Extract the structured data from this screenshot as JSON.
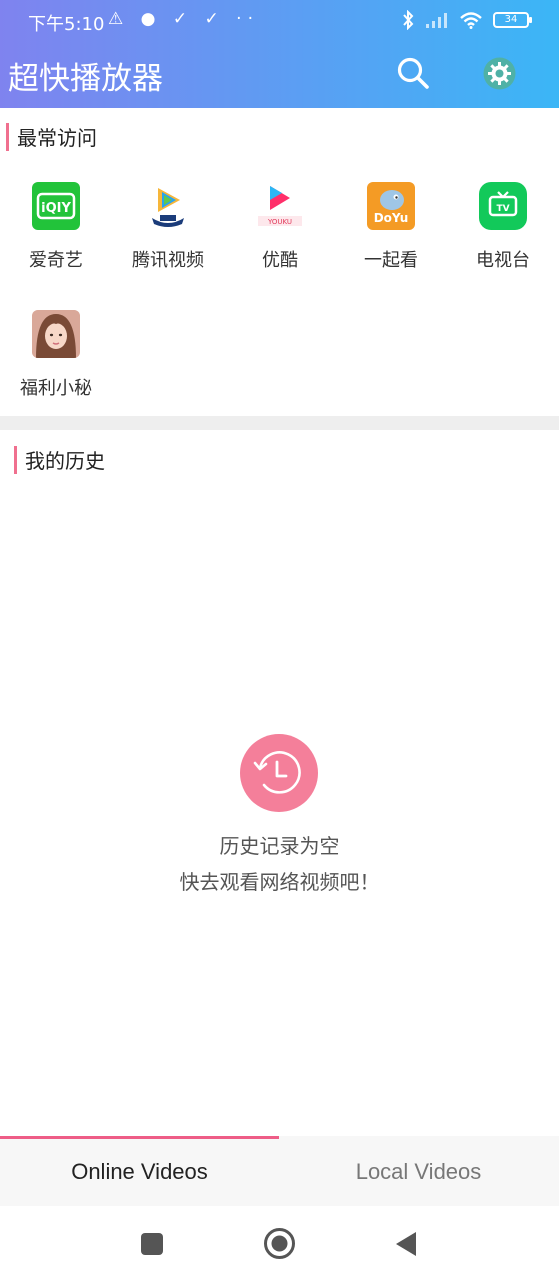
{
  "status_bar": {
    "time": "下午5:10",
    "left_icons": "⚠ ● ✓ ✓ ··",
    "battery": "34"
  },
  "header": {
    "title": "超快播放器",
    "search_icon": "search-icon",
    "settings_icon": "gear-icon"
  },
  "frequent": {
    "title": "最常访问",
    "items": [
      {
        "label": "爱奇艺",
        "icon": "iqiyi-icon",
        "color": "#22c33a"
      },
      {
        "label": "腾讯视频",
        "icon": "tencent-video-icon",
        "color": "#1e88e5"
      },
      {
        "label": "优酷",
        "icon": "youku-icon",
        "color": "#2aa9f5"
      },
      {
        "label": "一起看",
        "icon": "douyu-icon",
        "color": "#f49b25"
      },
      {
        "label": "电视台",
        "icon": "tv-icon",
        "color": "#12c95a"
      },
      {
        "label": "福利小秘",
        "icon": "avatar-icon",
        "color": "#e8b3a0"
      }
    ]
  },
  "history": {
    "title": "我的历史",
    "empty_line1": "历史记录为空",
    "empty_line2": "快去观看网络视频吧！",
    "empty_icon": "clock-icon"
  },
  "tabs": {
    "online": "Online Videos",
    "local": "Local Videos"
  },
  "colors": {
    "accent": "#ee5d87",
    "header_start": "#7f83ef",
    "header_end": "#3bb6f6"
  }
}
